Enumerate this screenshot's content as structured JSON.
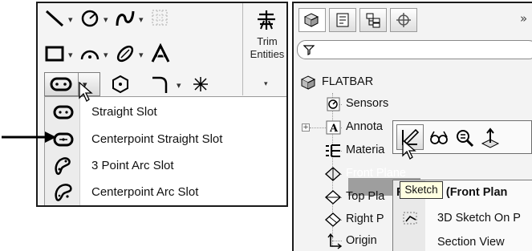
{
  "sketch_toolbar": {
    "trim_button": {
      "label_line1": "Trim",
      "label_line2": "Entities",
      "caret": "▾"
    },
    "dropdown_caret": "▾",
    "icons": [
      "line-icon",
      "circle-icon",
      "spline-icon",
      "grid-icon",
      "rectangle-icon",
      "arc-icon",
      "ellipse-icon",
      "text-icon",
      "slot-icon",
      "polygon-icon",
      "fillet-icon",
      "point-icon",
      "trim-entities-icon"
    ]
  },
  "slot_menu": {
    "items": [
      {
        "label": "Straight Slot",
        "icon": "straight-slot-icon"
      },
      {
        "label": "Centerpoint Straight Slot",
        "icon": "centerpoint-straight-slot-icon"
      },
      {
        "label": "3 Point Arc Slot",
        "icon": "3-point-arc-slot-icon"
      },
      {
        "label": "Centerpoint Arc Slot",
        "icon": "centerpoint-arc-slot-icon"
      }
    ]
  },
  "feature_manager": {
    "overflow": "»",
    "tree": {
      "root": "FLATBAR",
      "items": [
        {
          "label": "Sensors"
        },
        {
          "label": "Annota"
        },
        {
          "label": "Materia"
        },
        {
          "label": "Front Plane"
        },
        {
          "label": "Top Pla"
        },
        {
          "label": "Right P"
        },
        {
          "label": "Origin"
        }
      ]
    },
    "context_menu": {
      "title": "F",
      "title_rest": "(Front Plan",
      "items": [
        {
          "label": "3D Sketch On P"
        },
        {
          "label": "Section View"
        }
      ]
    },
    "tooltip": "Sketch"
  },
  "colors": {
    "panel_bg": "#f4f4f4",
    "highlight": "#9e9e9e",
    "tooltip_bg": "#ffffe1",
    "border": "#1a1a1a"
  }
}
